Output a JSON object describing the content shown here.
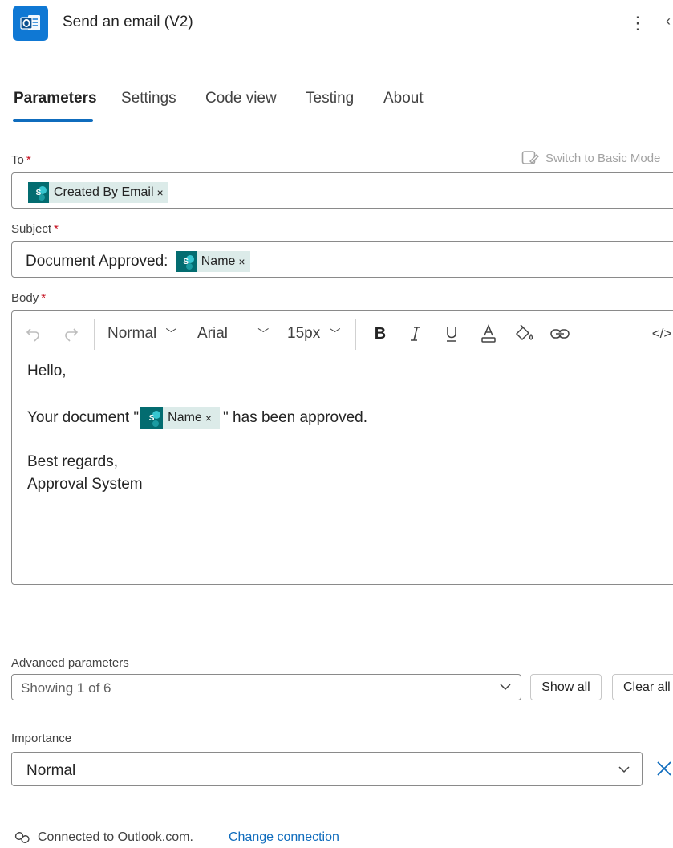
{
  "header": {
    "title": "Send an email (V2)",
    "more_icon": "more-vertical-icon",
    "app_icon": "outlook-icon"
  },
  "tabs": [
    {
      "label": "Parameters",
      "active": true
    },
    {
      "label": "Settings",
      "active": false
    },
    {
      "label": "Code view",
      "active": false
    },
    {
      "label": "Testing",
      "active": false
    },
    {
      "label": "About",
      "active": false
    }
  ],
  "switch_mode_label": "Switch to Basic Mode",
  "fields": {
    "to": {
      "label": "To",
      "required": "*",
      "token": "Created By Email"
    },
    "subject": {
      "label": "Subject",
      "required": "*",
      "prefix": "Document Approved:",
      "token": "Name"
    },
    "body": {
      "label": "Body",
      "required": "*",
      "toolbar": {
        "paragraph_style": "Normal",
        "font": "Arial",
        "size": "15px"
      },
      "lines": {
        "greeting": "Hello,",
        "sentence_before": "Your document \"",
        "token": "Name",
        "sentence_after": "\" has been approved.",
        "closing1": "Best regards,",
        "closing2": "Approval System"
      }
    }
  },
  "advanced": {
    "label": "Advanced parameters",
    "value": "Showing 1 of 6",
    "show_all": "Show all",
    "clear_all": "Clear all"
  },
  "importance": {
    "label": "Importance",
    "value": "Normal"
  },
  "footer": {
    "connected_text": "Connected to Outlook.com.",
    "change_connection": "Change connection"
  },
  "colors": {
    "accent": "#0f6cbd",
    "required": "#c50f1f",
    "token_bg": "#dcebe9",
    "sharepoint": "#036c70"
  }
}
